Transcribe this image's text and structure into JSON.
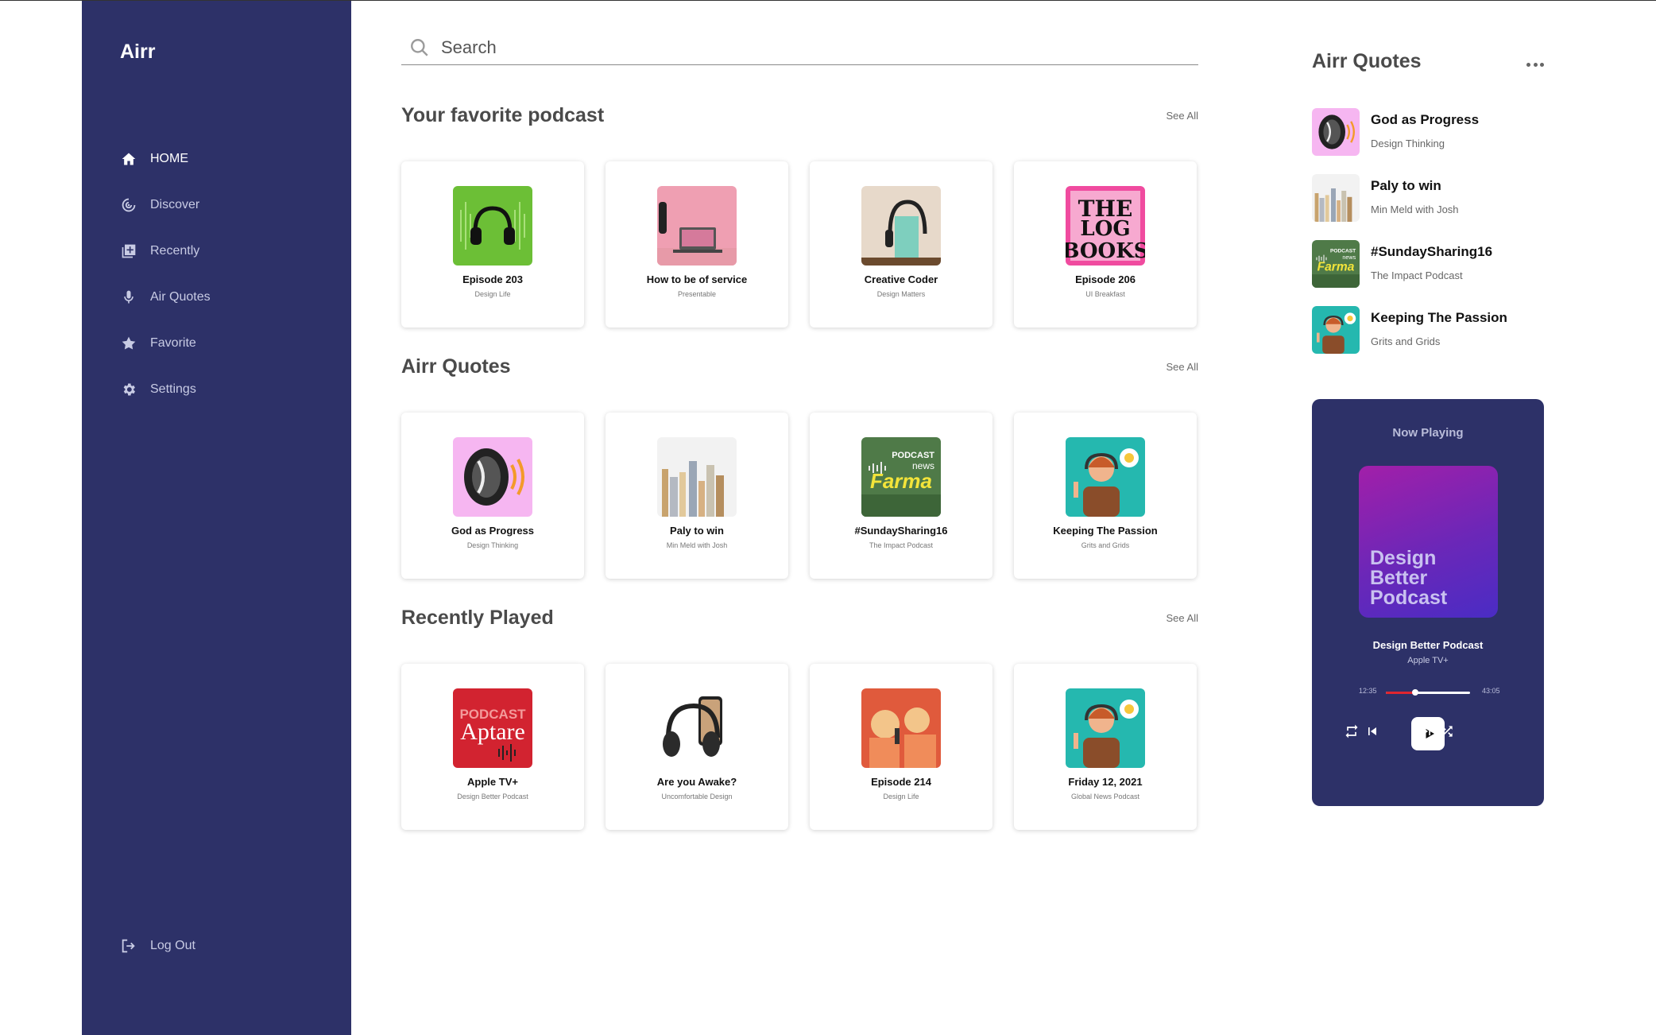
{
  "app": {
    "brand": "Airr"
  },
  "sidebar": {
    "items": [
      {
        "label": "HOME",
        "icon": "home-icon",
        "active": true
      },
      {
        "label": "Discover",
        "icon": "discover-icon",
        "active": false
      },
      {
        "label": "Recently",
        "icon": "recently-icon",
        "active": false
      },
      {
        "label": "Air Quotes",
        "icon": "microphone-icon",
        "active": false
      },
      {
        "label": "Favorite",
        "icon": "star-icon",
        "active": false
      },
      {
        "label": "Settings",
        "icon": "gear-icon",
        "active": false
      }
    ],
    "logout": "Log Out"
  },
  "search": {
    "placeholder": "Search"
  },
  "sections": [
    {
      "title": "Your favorite podcast",
      "see_all": "See All",
      "cards": [
        {
          "title": "Episode 203",
          "subtitle": "Design Life",
          "art": "headphones-green"
        },
        {
          "title": "How to be of service",
          "subtitle": "Presentable",
          "art": "laptop-pink"
        },
        {
          "title": "Creative Coder",
          "subtitle": "Design Matters",
          "art": "headphones-book"
        },
        {
          "title": "Episode 206",
          "subtitle": "UI Breakfast",
          "art": "the-log-books"
        }
      ]
    },
    {
      "title": "Airr Quotes",
      "see_all": "See All",
      "cards": [
        {
          "title": "God as Progress",
          "subtitle": "Design Thinking",
          "art": "mouth"
        },
        {
          "title": "Paly to win",
          "subtitle": "Min Meld with Josh",
          "art": "books"
        },
        {
          "title": "#SundaySharing16",
          "subtitle": "The Impact Podcast",
          "art": "farma"
        },
        {
          "title": "Keeping The Passion",
          "subtitle": "Grits and Grids",
          "art": "host-teal"
        }
      ]
    },
    {
      "title": "Recently Played",
      "see_all": "See All",
      "cards": [
        {
          "title": "Apple TV+",
          "subtitle": "Design Better Podcast",
          "art": "aptare"
        },
        {
          "title": "Are you Awake?",
          "subtitle": "Uncomfortable Design",
          "art": "headphones-phone"
        },
        {
          "title": "Episode 214",
          "subtitle": "Design Life",
          "art": "illustration-red"
        },
        {
          "title": "Friday 12, 2021",
          "subtitle": "Global News Podcast",
          "art": "host-teal"
        }
      ]
    }
  ],
  "right_panel": {
    "title": "Airr Quotes",
    "items": [
      {
        "title": "God as Progress",
        "subtitle": "Design Thinking",
        "art": "mouth"
      },
      {
        "title": "Paly to win",
        "subtitle": "Min Meld with Josh",
        "art": "books"
      },
      {
        "title": "#SundaySharing16",
        "subtitle": "The Impact Podcast",
        "art": "farma"
      },
      {
        "title": "Keeping The Passion",
        "subtitle": "Grits and Grids",
        "art": "host-teal"
      }
    ]
  },
  "player": {
    "label": "Now Playing",
    "art_text": "Design Better Podcast",
    "title": "Design Better Podcast",
    "subtitle": "Apple TV+",
    "elapsed": "12:35",
    "duration": "43:05",
    "progress": 0.35
  },
  "art_text": {
    "log": "THE LOG BOOKS",
    "farma_top": "PODCAST",
    "farma_mid": "news",
    "farma_main": "Farma",
    "aptare_top": "PODCAST",
    "aptare_main": "Aptare"
  },
  "colors": {
    "sidebar": "#2d3168",
    "accent_red": "#e0262f"
  }
}
